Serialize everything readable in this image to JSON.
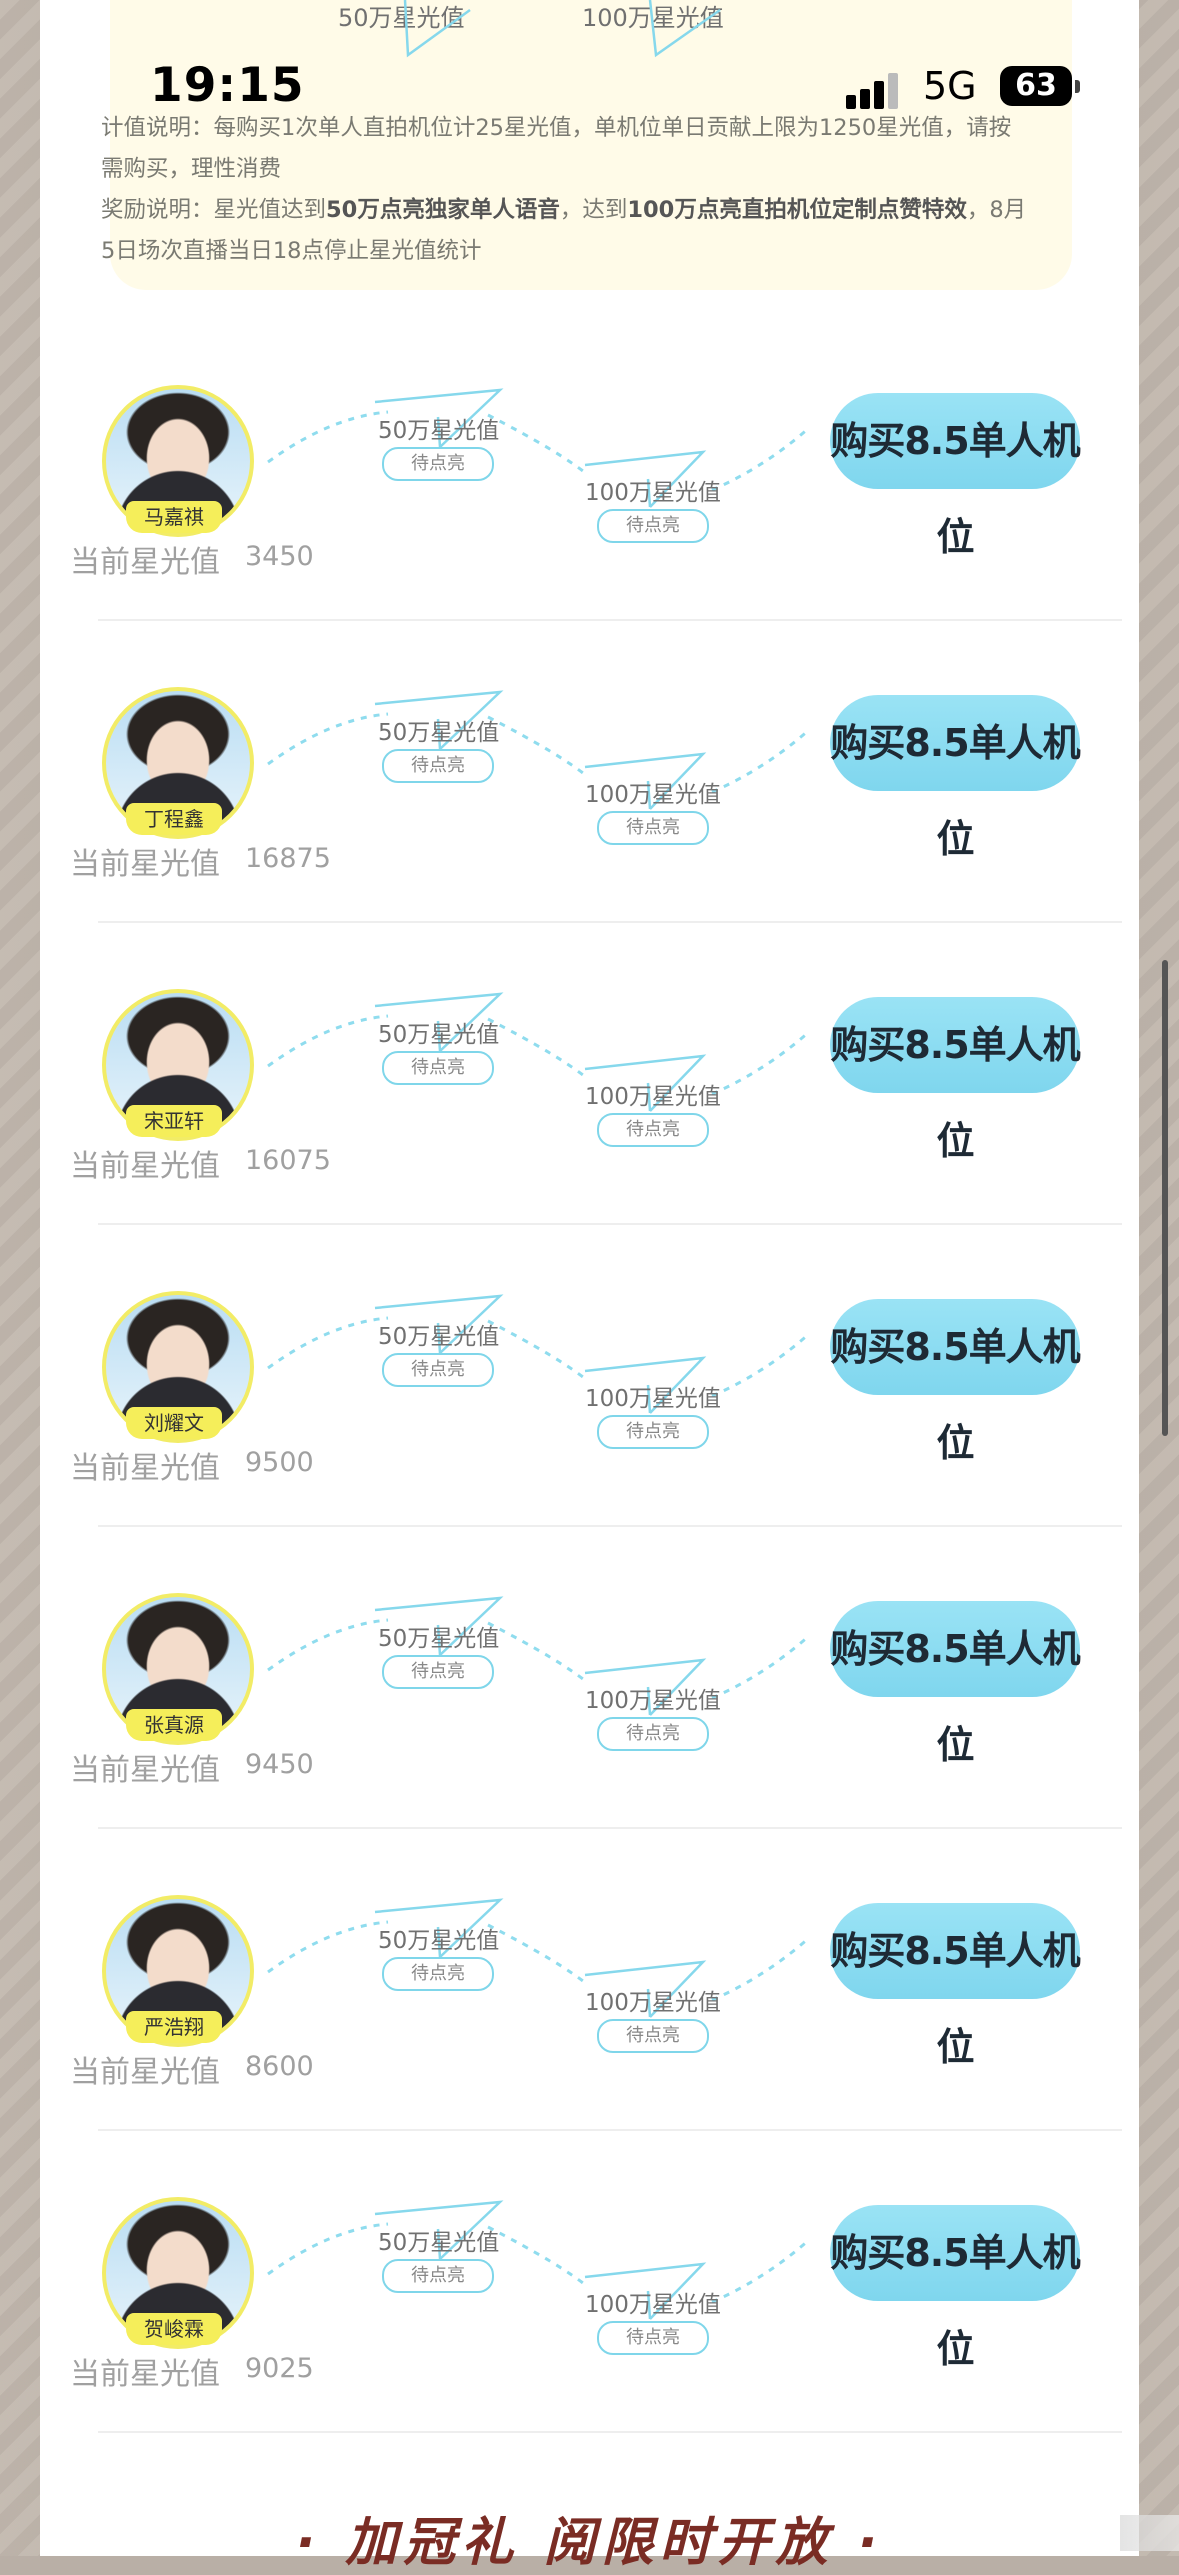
{
  "status": {
    "time": "19:15",
    "network": "5G",
    "battery": "63"
  },
  "top_card": {
    "milestone_50": "50万星光值",
    "milestone_100": "100万星光值",
    "calc_label": "计值说明：",
    "calc_text": "每购买1次单人直拍机位计25星光值，单机位单日贡献上限为1250星光值，请按需购买，理性消费",
    "reward_label": "奖励说明：",
    "reward_pre": "星光值达到",
    "reward_b1": "50万点亮独家单人语音",
    "reward_mid": "，达到",
    "reward_b2": "100万点亮直拍机位定制点赞特效",
    "reward_post": "，8月5日场次直播当日18点停止星光值统计"
  },
  "milestones": {
    "m1": "50万星光值",
    "m2": "100万星光值",
    "status": "待点亮"
  },
  "current_label": "当前星光值",
  "buy_label": "购买8.5单人机位",
  "members": [
    {
      "name": "马嘉祺",
      "value": "3450"
    },
    {
      "name": "丁程鑫",
      "value": "16875"
    },
    {
      "name": "宋亚轩",
      "value": "16075"
    },
    {
      "name": "刘耀文",
      "value": "9500"
    },
    {
      "name": "张真源",
      "value": "9450"
    },
    {
      "name": "严浩翔",
      "value": "8600"
    },
    {
      "name": "贺峻霖",
      "value": "9025"
    }
  ],
  "footer_title": "· 加冠礼 阅限时开放 ·",
  "colors": {
    "accent": "#7fd6ee",
    "card_bg": "#fffbe8",
    "name_tag": "#f5ee5a"
  }
}
